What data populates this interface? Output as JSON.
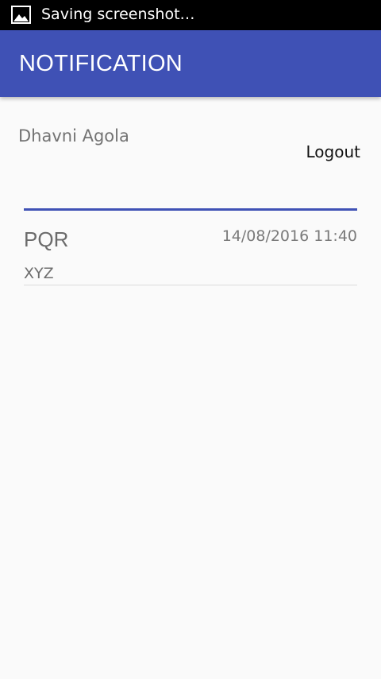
{
  "status_bar": {
    "text": "Saving screenshot…",
    "icon": "image-icon"
  },
  "app_bar": {
    "title": "NOTIFICATION",
    "color": "#3f51b5"
  },
  "header": {
    "user_name": "Dhavni Agola",
    "logout_label": "Logout"
  },
  "notifications": [
    {
      "title": "PQR",
      "date": "14/08/2016 11:40",
      "message": "XYZ",
      "accent_color": "#3f51b5"
    }
  ]
}
